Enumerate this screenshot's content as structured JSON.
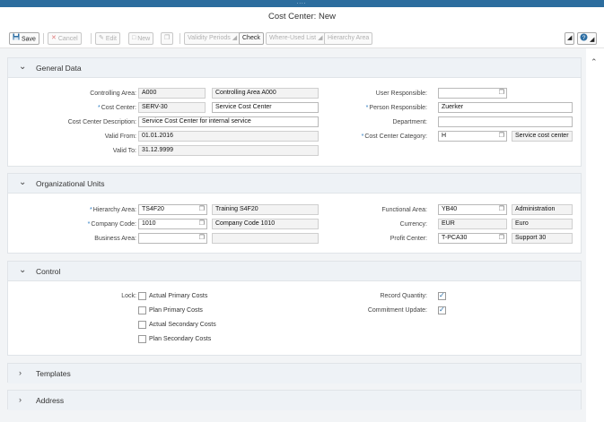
{
  "window": {
    "title": "Cost Center: New",
    "grip": "...."
  },
  "toolbar": {
    "save": "Save",
    "cancel": "Cancel",
    "edit": "Edit",
    "new": "New",
    "validity_periods": "Validity Periods",
    "check": "Check",
    "where_used_list": "Where-Used List",
    "hierarchy_area": "Hierarchy Area"
  },
  "general": {
    "title": "General Data",
    "controlling_area_label": "Controlling Area:",
    "controlling_area": "A000",
    "controlling_area_text": "Controlling Area A000",
    "cost_center_label": "Cost Center:",
    "cost_center": "SERV-30",
    "cost_center_name": "Service Cost Center",
    "description_label": "Cost Center Description:",
    "description": "Service Cost Center for internal service",
    "valid_from_label": "Valid From:",
    "valid_from": "01.01.2016",
    "valid_to_label": "Valid To:",
    "valid_to": "31.12.9999",
    "user_responsible_label": "User Responsible:",
    "user_responsible": "",
    "person_responsible_label": "Person Responsible:",
    "person_responsible": "Zuerker",
    "department_label": "Department:",
    "department": "",
    "category_label": "Cost Center Category:",
    "category": "H",
    "category_text": "Service cost center"
  },
  "org": {
    "title": "Organizational Units",
    "hierarchy_area_label": "Hierarchy Area:",
    "hierarchy_area": "TS4F20",
    "hierarchy_area_text": "Training S4F20",
    "company_code_label": "Company Code:",
    "company_code": "1010",
    "company_code_text": "Company Code 1010",
    "business_area_label": "Business Area:",
    "business_area": "",
    "business_area_text": "",
    "functional_area_label": "Functional Area:",
    "functional_area": "YB40",
    "functional_area_text": "Administration",
    "currency_label": "Currency:",
    "currency": "EUR",
    "currency_text": "Euro",
    "profit_center_label": "Profit Center:",
    "profit_center": "T-PCA30",
    "profit_center_text": "Support 30"
  },
  "control": {
    "title": "Control",
    "lock_label": "Lock:",
    "lock_options": [
      {
        "label": "Actual Primary Costs",
        "checked": false
      },
      {
        "label": "Plan Primary Costs",
        "checked": false
      },
      {
        "label": "Actual Secondary Costs",
        "checked": false
      },
      {
        "label": "Plan Secondary Costs",
        "checked": false
      }
    ],
    "record_quantity_label": "Record Quantity:",
    "record_quantity": true,
    "commitment_update_label": "Commitment Update:",
    "commitment_update": true
  },
  "templates": {
    "title": "Templates"
  },
  "address": {
    "title": "Address"
  },
  "icons": {
    "save": "floppy-disk-icon",
    "cancel": "x-icon",
    "edit": "pencil-icon",
    "new": "page-icon",
    "copy": "copy-icon",
    "value_help": "value-help-icon",
    "help": "help-icon"
  },
  "colors": {
    "top_bar": "#2c6d9e",
    "required_marker": "#2b7bc2",
    "panel_header": "#eef2f6"
  }
}
